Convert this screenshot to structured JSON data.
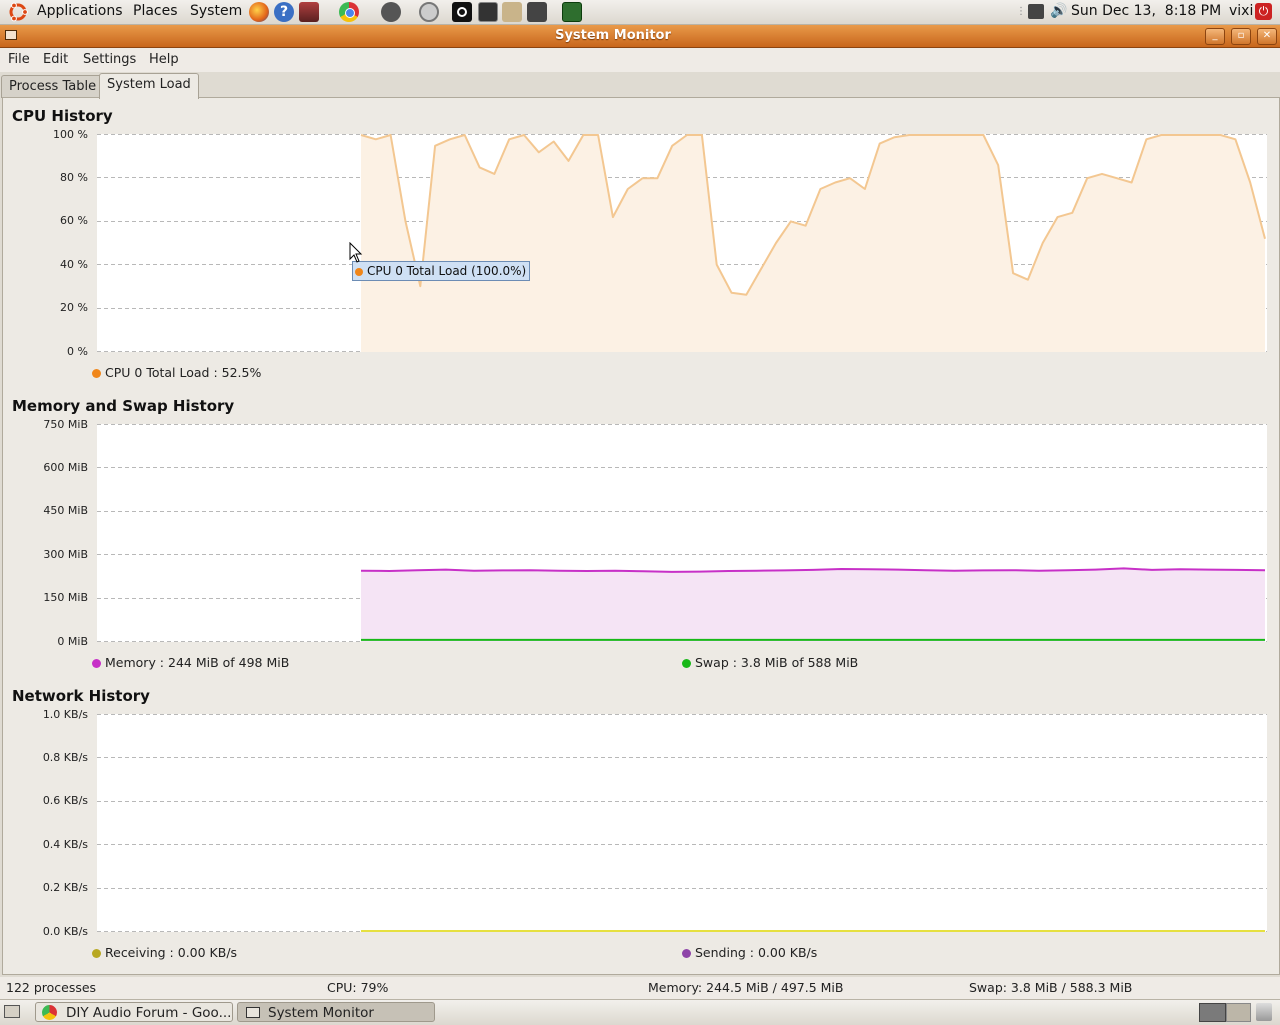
{
  "top_panel": {
    "menus": [
      "Applications",
      "Places",
      "System"
    ],
    "clock": "Sun Dec 13,  8:18 PM",
    "user": "vixi"
  },
  "window": {
    "title": "System Monitor",
    "menu": [
      "File",
      "Edit",
      "Settings",
      "Help"
    ],
    "tabs": [
      "Process Table",
      "System Load"
    ],
    "active_tab": "System Load"
  },
  "cpu": {
    "title": "CPU History",
    "yticks": [
      "100 %",
      "80 %",
      "60 %",
      "40 %",
      "20 %",
      "0 %"
    ],
    "legend": "CPU 0 Total Load : 52.5%",
    "color": "#f4a244",
    "tooltip": "CPU 0 Total Load (100.0%)"
  },
  "memory": {
    "title": "Memory and Swap History",
    "yticks": [
      "750 MiB",
      "600 MiB",
      "450 MiB",
      "300 MiB",
      "150 MiB",
      "0 MiB"
    ],
    "legend_memory": "Memory : 244 MiB of 498 MiB",
    "legend_swap": "Swap : 3.8 MiB of 588 MiB",
    "memory_color": "#c730c7",
    "swap_color": "#18b818"
  },
  "network": {
    "title": "Network History",
    "yticks": [
      "1.0 KB/s",
      "0.8 KB/s",
      "0.6 KB/s",
      "0.4 KB/s",
      "0.2 KB/s",
      "0.0 KB/s"
    ],
    "legend_receiving": "Receiving : 0.00 KB/s",
    "legend_sending": "Sending : 0.00 KB/s",
    "receiving_color": "#b8a822",
    "sending_color": "#8e44a8"
  },
  "status": {
    "processes": "122 processes",
    "cpu": "CPU: 79%",
    "memory": "Memory: 244.5 MiB / 497.5 MiB",
    "swap": "Swap: 3.8 MiB / 588.3 MiB"
  },
  "taskbar": {
    "tasks": [
      "DIY Audio Forum - Goo...",
      "System Monitor"
    ]
  },
  "chart_data": [
    {
      "type": "area",
      "title": "CPU History",
      "ylabel": "",
      "ylim": [
        0,
        100
      ],
      "series": [
        {
          "name": "CPU 0 Total Load",
          "values": [
            100,
            98,
            100,
            60,
            30,
            95,
            98,
            100,
            85,
            82,
            98,
            100,
            92,
            97,
            88,
            100,
            100,
            62,
            75,
            80,
            80,
            95,
            100,
            100,
            40,
            27,
            26,
            38,
            50,
            60,
            58,
            75,
            78,
            80,
            75,
            96,
            99,
            100,
            100,
            100,
            100,
            100,
            100,
            86,
            36,
            33,
            50,
            62,
            64,
            80,
            82,
            80,
            78,
            98,
            100,
            100,
            100,
            100,
            100,
            98,
            78,
            52
          ]
        }
      ]
    },
    {
      "type": "area",
      "title": "Memory and Swap History",
      "ylabel": "",
      "ylim": [
        0,
        750
      ],
      "series": [
        {
          "name": "Memory",
          "values": [
            244,
            243,
            246,
            248,
            244,
            245,
            246,
            244,
            243,
            244,
            242,
            240,
            241,
            243,
            244,
            245,
            247,
            250,
            249,
            248,
            246,
            244,
            245,
            246,
            244,
            246,
            248,
            252,
            247,
            249,
            248,
            247,
            246
          ]
        },
        {
          "name": "Swap",
          "values": [
            3.8,
            3.8,
            3.8,
            3.8,
            3.8,
            3.8,
            3.8,
            3.8,
            3.8,
            3.8,
            3.8,
            3.8,
            3.8,
            3.8,
            3.8,
            3.8,
            3.8,
            3.8,
            3.8,
            3.8,
            3.8,
            3.8,
            3.8,
            3.8,
            3.8,
            3.8,
            3.8,
            3.8,
            3.8,
            3.8,
            3.8,
            3.8,
            3.8
          ]
        }
      ]
    },
    {
      "type": "line",
      "title": "Network History",
      "ylabel": "",
      "ylim": [
        0,
        1.0
      ],
      "series": [
        {
          "name": "Receiving",
          "values": [
            0,
            0,
            0,
            0,
            0,
            0,
            0,
            0,
            0,
            0
          ]
        },
        {
          "name": "Sending",
          "values": [
            0,
            0,
            0,
            0,
            0,
            0,
            0,
            0,
            0,
            0
          ]
        }
      ]
    }
  ]
}
